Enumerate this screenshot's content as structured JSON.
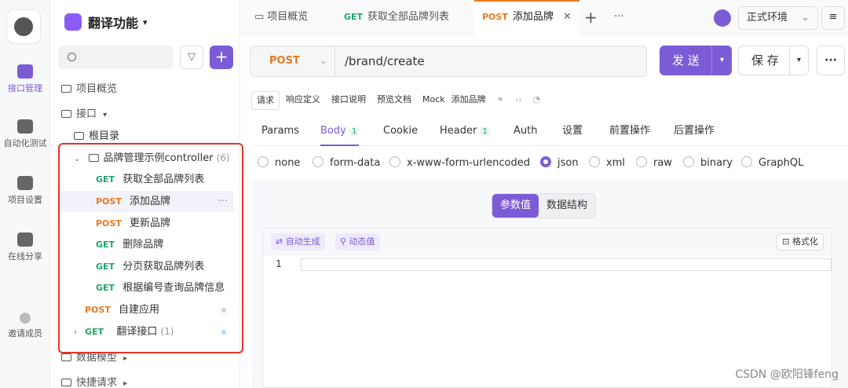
{
  "rail": {
    "items": [
      {
        "label": "接口管理"
      },
      {
        "label": "自动化测试"
      },
      {
        "label": "项目设置"
      },
      {
        "label": "在线分享"
      },
      {
        "label": "邀请成员"
      }
    ]
  },
  "sidebar": {
    "project_title": "翻译功能",
    "title_caret": "▾",
    "search_placeholder": "",
    "overview": "项目概览",
    "api_section": "接口",
    "root": "根目录",
    "folder": {
      "name": "品牌管理示例controller",
      "count": "(6)"
    },
    "endpoints": [
      {
        "method": "GET",
        "name": "获取全部品牌列表"
      },
      {
        "method": "POST",
        "name": "添加品牌",
        "more": "···"
      },
      {
        "method": "POST",
        "name": "更新品牌"
      },
      {
        "method": "GET",
        "name": "删除品牌"
      },
      {
        "method": "GET",
        "name": "分页获取品牌列表"
      },
      {
        "method": "GET",
        "name": "根据编号查询品牌信息"
      }
    ],
    "extra": [
      {
        "method": "POST",
        "name": "自建应用"
      },
      {
        "method": "GET",
        "name": "翻译接口",
        "count": "(1)"
      }
    ],
    "data_model": "数据模型",
    "quick_request": "快捷请求"
  },
  "tabs": {
    "items": [
      {
        "label": "项目概览"
      },
      {
        "method": "GET",
        "label": "获取全部品牌列表"
      },
      {
        "method": "POST",
        "label": "添加品牌",
        "close": "✕"
      }
    ],
    "add": "+",
    "more": "···",
    "env": "正式环境",
    "env_caret": "⌄",
    "menu": "≡"
  },
  "request": {
    "method": "POST",
    "method_caret": "⌄",
    "url": "/brand/create",
    "send": "发 送",
    "save": "保 存",
    "dropdown": "▾",
    "dots": "···"
  },
  "subtabs": [
    "请求",
    "响应定义",
    "接口说明",
    "预览文档",
    "Mock",
    "添加品牌"
  ],
  "reqtabs": [
    {
      "label": "Params"
    },
    {
      "label": "Body",
      "badge": "1"
    },
    {
      "label": "Cookie"
    },
    {
      "label": "Header",
      "badge": "1"
    },
    {
      "label": "Auth"
    },
    {
      "label": "设置"
    },
    {
      "label": "前置操作"
    },
    {
      "label": "后置操作"
    }
  ],
  "body_types": [
    "none",
    "form-data",
    "x-www-form-urlencoded",
    "json",
    "xml",
    "raw",
    "binary",
    "GraphQL"
  ],
  "selected_body_type": "json",
  "segment": [
    "参数值",
    "数据结构"
  ],
  "editor": {
    "auto_gen": "⇄ 自动生成",
    "dynamic": "⚲ 动态值",
    "format": "⊡ 格式化",
    "line1": "1"
  },
  "watermark": "CSDN @欧阳锋feng"
}
